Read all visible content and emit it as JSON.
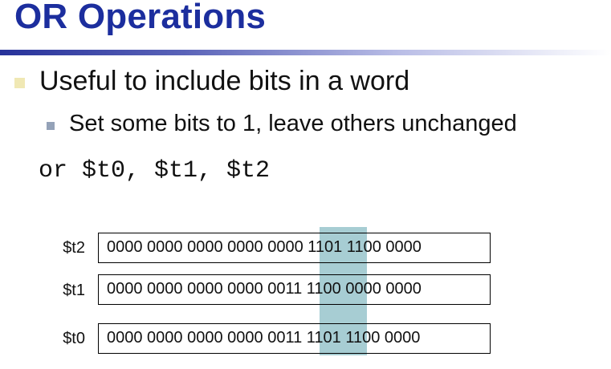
{
  "slide": {
    "title": "OR Operations",
    "bullets": [
      {
        "text": "Useful to include bits in a word",
        "sub_bullets": [
          "Set some bits to 1, leave others unchanged"
        ]
      }
    ],
    "code": "or $t0, $t1, $t2",
    "registers": [
      {
        "name": "$t2",
        "bits": "0000 0000 0000 0000 0000 1101 1100 0000"
      },
      {
        "name": "$t1",
        "bits": "0000 0000 0000 0000 0011 1100 0000 0000"
      },
      {
        "name": "$t0",
        "bits": "0000 0000 0000 0000 0011 1101 1100 0000"
      }
    ]
  },
  "colors": {
    "title": "#1c2e9e",
    "highlight": "#a7cdd3",
    "bullet_level1": "#f0e8b4",
    "bullet_level2": "#94a2b8"
  }
}
